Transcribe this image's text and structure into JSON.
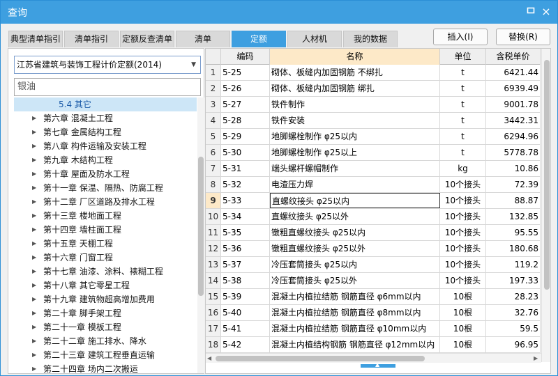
{
  "window": {
    "title": "查询",
    "minimize_icon": "maximize-icon",
    "close_label": "×"
  },
  "tabs": [
    {
      "label": "典型清单指引",
      "active": false
    },
    {
      "label": "清单指引",
      "active": false
    },
    {
      "label": "定额反查清单",
      "active": false
    },
    {
      "label": "清单",
      "active": false
    },
    {
      "label": "定额",
      "active": true
    },
    {
      "label": "人材机",
      "active": false
    },
    {
      "label": "我的数据",
      "active": false
    }
  ],
  "actions": {
    "insert": "插入(I)",
    "replace": "替换(R)"
  },
  "left": {
    "dropdown_value": "江苏省建筑与装饰工程计价定额(2014)",
    "search_value": "银油",
    "tree": [
      {
        "label": "5.4 其它",
        "sub": true,
        "selected": true
      },
      {
        "label": "第六章 混凝土工程"
      },
      {
        "label": "第七章 金属结构工程"
      },
      {
        "label": "第八章 构件运输及安装工程"
      },
      {
        "label": "第九章 木结构工程"
      },
      {
        "label": "第十章 屋面及防水工程"
      },
      {
        "label": "第十一章 保温、隔热、防腐工程"
      },
      {
        "label": "第十二章 厂区道路及排水工程"
      },
      {
        "label": "第十三章 楼地面工程"
      },
      {
        "label": "第十四章 墙柱面工程"
      },
      {
        "label": "第十五章 天棚工程"
      },
      {
        "label": "第十六章 门窗工程"
      },
      {
        "label": "第十七章 油漆、涂料、裱糊工程"
      },
      {
        "label": "第十八章 其它零星工程"
      },
      {
        "label": "第十九章 建筑物超高增加费用"
      },
      {
        "label": "第二十章 脚手架工程"
      },
      {
        "label": "第二十一章 模板工程"
      },
      {
        "label": "第二十二章 施工排水、降水"
      },
      {
        "label": "第二十三章 建筑工程垂直运输"
      },
      {
        "label": "第二十四章 场内二次搬运"
      }
    ]
  },
  "grid": {
    "headers": {
      "code": "编码",
      "name": "名称",
      "unit": "单位",
      "price": "含税单价"
    },
    "rows": [
      {
        "num": "1",
        "code": "5-25",
        "name": "砌体、板缝内加固钢筋 不绑扎",
        "unit": "t",
        "price": "6421.44"
      },
      {
        "num": "2",
        "code": "5-26",
        "name": "砌体、板缝内加固钢筋 绑扎",
        "unit": "t",
        "price": "6939.49"
      },
      {
        "num": "3",
        "code": "5-27",
        "name": "铁件制作",
        "unit": "t",
        "price": "9001.78"
      },
      {
        "num": "4",
        "code": "5-28",
        "name": "铁件安装",
        "unit": "t",
        "price": "3442.31"
      },
      {
        "num": "5",
        "code": "5-29",
        "name": "地脚螺栓制作 φ25以内",
        "unit": "t",
        "price": "6294.96"
      },
      {
        "num": "6",
        "code": "5-30",
        "name": "地脚螺栓制作 φ25以上",
        "unit": "t",
        "price": "5778.78"
      },
      {
        "num": "7",
        "code": "5-31",
        "name": "端头螺杆螺帽制作",
        "unit": "kg",
        "price": "10.86"
      },
      {
        "num": "8",
        "code": "5-32",
        "name": "电渣压力焊",
        "unit": "10个接头",
        "price": "72.39"
      },
      {
        "num": "9",
        "code": "5-33",
        "name": "直螺纹接头 φ25以内",
        "unit": "10个接头",
        "price": "88.87",
        "current": true
      },
      {
        "num": "10",
        "code": "5-34",
        "name": "直螺纹接头 φ25以外",
        "unit": "10个接头",
        "price": "132.85"
      },
      {
        "num": "11",
        "code": "5-35",
        "name": "镦粗直螺纹接头 φ25以内",
        "unit": "10个接头",
        "price": "95.55"
      },
      {
        "num": "12",
        "code": "5-36",
        "name": "镦粗直螺纹接头 φ25以外",
        "unit": "10个接头",
        "price": "180.68"
      },
      {
        "num": "13",
        "code": "5-37",
        "name": "冷压套筒接头 φ25以内",
        "unit": "10个接头",
        "price": "119.2"
      },
      {
        "num": "14",
        "code": "5-38",
        "name": "冷压套筒接头 φ25以外",
        "unit": "10个接头",
        "price": "197.33"
      },
      {
        "num": "15",
        "code": "5-39",
        "name": "混凝土内植拉结筋 钢筋直径 φ6mm以内",
        "unit": "10根",
        "price": "28.23"
      },
      {
        "num": "16",
        "code": "5-40",
        "name": "混凝土内植拉结筋 钢筋直径 φ8mm以内",
        "unit": "10根",
        "price": "32.76"
      },
      {
        "num": "17",
        "code": "5-41",
        "name": "混凝土内植拉结筋 钢筋直径 φ10mm以内",
        "unit": "10根",
        "price": "59.5"
      },
      {
        "num": "18",
        "code": "5-42",
        "name": "混凝土内植结构钢筋 钢筋直径 φ12mm以内",
        "unit": "10根",
        "price": "96.95"
      }
    ]
  }
}
